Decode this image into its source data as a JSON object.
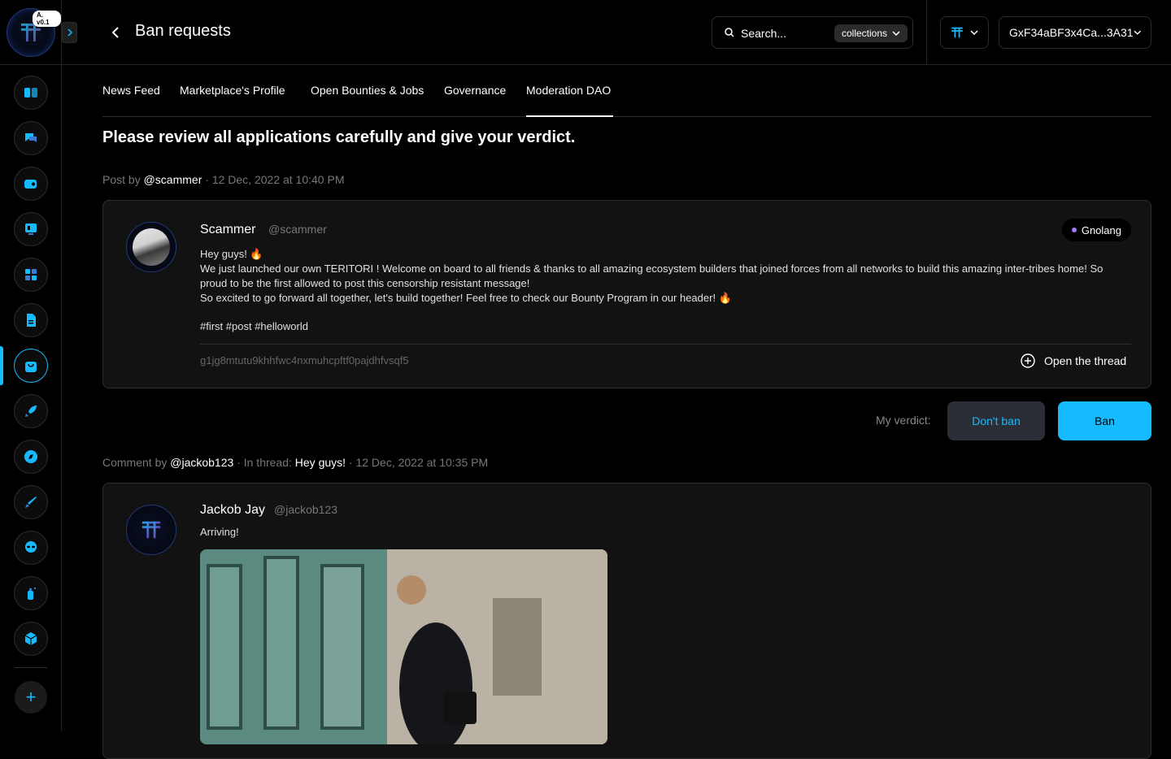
{
  "app": {
    "version_badge": "A. v0.1",
    "accent_color": "#16bbff",
    "sidebar_items": [
      {
        "name": "sidebar-item-dashboard",
        "icon": "dashboard-icon"
      },
      {
        "name": "sidebar-item-chat",
        "icon": "chat-icon"
      },
      {
        "name": "sidebar-item-wallet",
        "icon": "wallet-icon"
      },
      {
        "name": "sidebar-item-launchpad",
        "icon": "launchpad-icon"
      },
      {
        "name": "sidebar-item-apps",
        "icon": "apps-icon"
      },
      {
        "name": "sidebar-item-docs",
        "icon": "document-icon"
      },
      {
        "name": "sidebar-item-marketplace",
        "icon": "bag-icon",
        "active": true
      },
      {
        "name": "sidebar-item-rocket",
        "icon": "rocket-icon"
      },
      {
        "name": "sidebar-item-explore",
        "icon": "compass-icon"
      },
      {
        "name": "sidebar-item-pen",
        "icon": "pen-icon"
      },
      {
        "name": "sidebar-item-alien",
        "icon": "alien-icon"
      },
      {
        "name": "sidebar-item-drops",
        "icon": "spray-icon"
      },
      {
        "name": "sidebar-item-web3",
        "icon": "cube-icon"
      }
    ]
  },
  "header": {
    "title": "Ban requests",
    "search_placeholder": "Search...",
    "search_scope": "collections",
    "wallet_address": "GxF34aBF3x4Ca...3A31"
  },
  "tabs": [
    {
      "label": "News Feed"
    },
    {
      "label": "Marketplace's Profile"
    },
    {
      "label": "Open Bounties & Jobs"
    },
    {
      "label": "Governance"
    },
    {
      "label": "Moderation DAO",
      "active": true
    }
  ],
  "instructions": "Please review all applications carefully and give your verdict.",
  "post1": {
    "meta_prefix": "Post by",
    "meta_user": "@scammer",
    "meta_date": "· 12 Dec, 2022 at 10:40 PM",
    "author_name": "Scammer",
    "author_handle": "@scammer",
    "chain": "Gnolang",
    "line1": "Hey guys! 🔥",
    "line2": "We just launched our own TERITORI ! Welcome on board to all friends & thanks to all amazing ecosystem builders that joined forces from all networks to build this amazing inter-tribes home! So proud to be the first allowed to post this censorship resistant message!",
    "line3": "So excited to go forward all together, let's build together! Feel free to check our Bounty Program in our header! 🔥",
    "hashtags": "#first #post #helloworld",
    "post_id": "g1jg8mtutu9khhfwc4nxmuhcpftf0pajdhfvsqf5",
    "open_thread": "Open the thread"
  },
  "verdict": {
    "label": "My verdict:",
    "dont_ban": "Don't ban",
    "ban": "Ban"
  },
  "comment1": {
    "meta_prefix": "Comment by",
    "meta_user": "@jackob123",
    "meta_thread_prefix": "· In thread:",
    "meta_thread": "Hey guys!",
    "meta_date": "· 12 Dec, 2022 at 10:35 PM",
    "author_name": "Jackob Jay",
    "author_handle": "@jackob123",
    "text": "Arriving!"
  }
}
